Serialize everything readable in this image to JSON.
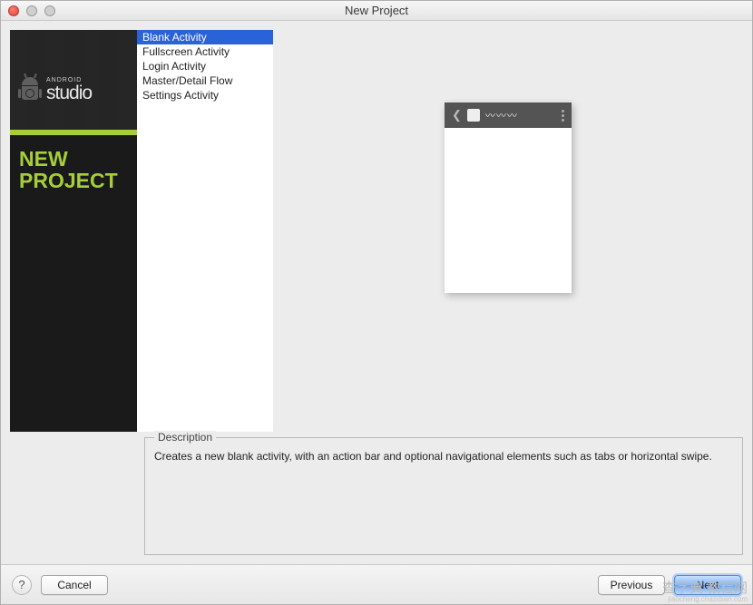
{
  "window": {
    "title": "New Project"
  },
  "banner": {
    "brand_small": "ANDROID",
    "brand_big": "studio",
    "heading_line1": "NEW",
    "heading_line2": "PROJECT"
  },
  "activities": [
    {
      "label": "Blank Activity",
      "selected": true
    },
    {
      "label": "Fullscreen Activity",
      "selected": false
    },
    {
      "label": "Login Activity",
      "selected": false
    },
    {
      "label": "Master/Detail Flow",
      "selected": false
    },
    {
      "label": "Settings Activity",
      "selected": false
    }
  ],
  "preview": {
    "title_glyph": "〰〰〰"
  },
  "description": {
    "legend": "Description",
    "text": "Creates a new blank activity, with an action bar and optional navigational elements such as tabs or horizontal swipe."
  },
  "buttons": {
    "help": "?",
    "cancel": "Cancel",
    "previous": "Previous",
    "next": "Next"
  },
  "watermark": {
    "zh": "查字典 教程网",
    "url": "jiaocheng.chazidian.com"
  }
}
